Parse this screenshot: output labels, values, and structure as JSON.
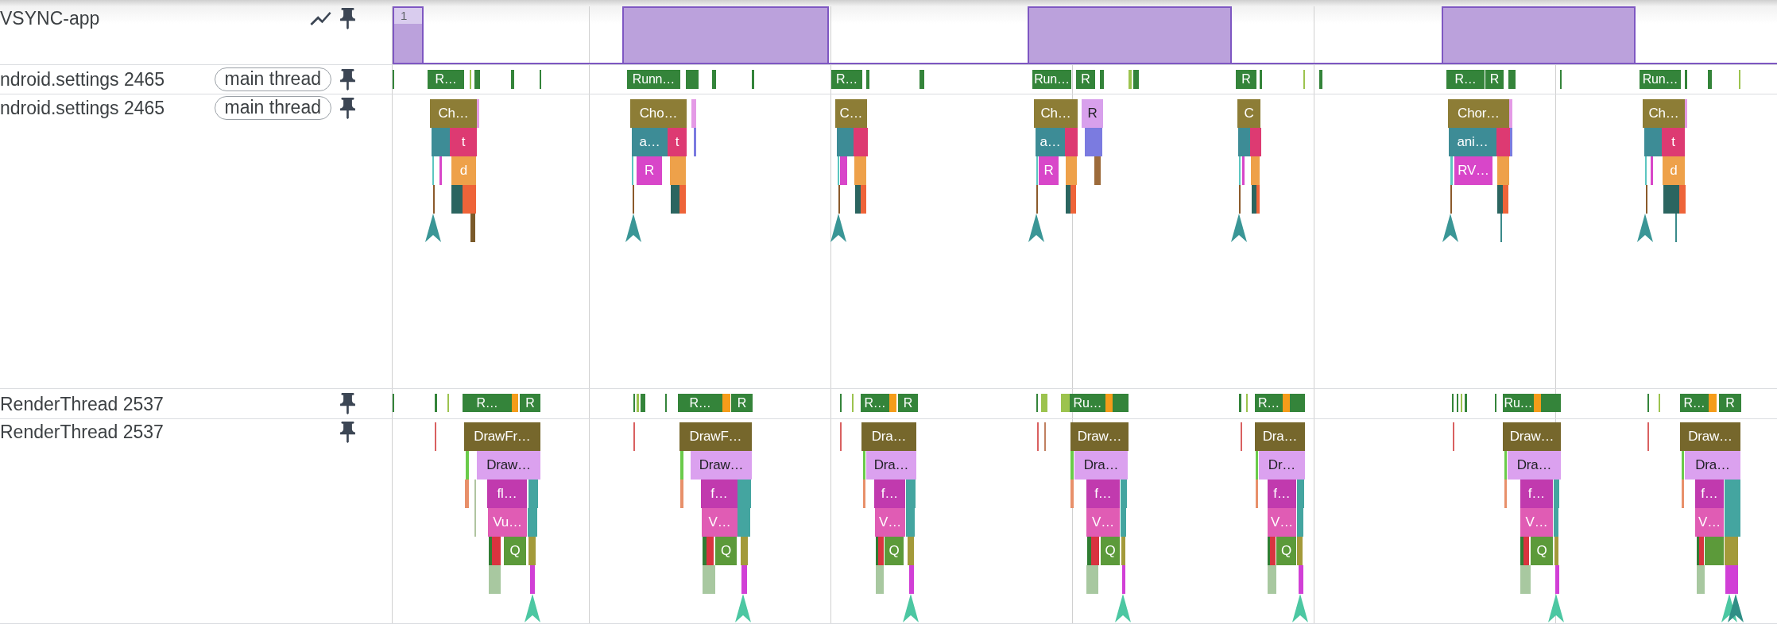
{
  "tracks": [
    {
      "kind": "counter",
      "title": "VSYNC-app",
      "value_label": "1"
    },
    {
      "kind": "thread_state",
      "title": "ndroid.settings 2465",
      "chip": "main thread",
      "slices": [
        {
          "color": "#34843a"
        },
        {
          "label": "R…",
          "color": "#34843a"
        },
        {
          "color": "#9cc34e"
        },
        {
          "color": "#34843a"
        },
        {
          "color": "#34843a"
        },
        {
          "color": "#34843a"
        },
        {
          "label": "Runn…",
          "color": "#34843a"
        },
        {
          "color": "#34843a"
        },
        {
          "color": "#34843a"
        },
        {
          "color": "#34843a"
        },
        {
          "label": "R…",
          "color": "#34843a"
        },
        {
          "color": "#34843a"
        },
        {
          "color": "#34843a"
        },
        {
          "label": "Run…",
          "color": "#34843a"
        },
        {
          "label": "R",
          "color": "#34843a"
        },
        {
          "color": "#34843a"
        },
        {
          "color": "#9cc34e"
        },
        {
          "color": "#34843a"
        },
        {
          "label": "R",
          "color": "#34843a"
        },
        {
          "color": "#34843a"
        },
        {
          "color": "#9cc34e"
        },
        {
          "color": "#34843a"
        },
        {
          "label": "R…",
          "color": "#34843a"
        },
        {
          "label": "R",
          "color": "#34843a"
        },
        {
          "color": "#34843a"
        },
        {
          "color": "#34843a"
        },
        {
          "label": "Run…",
          "color": "#34843a"
        },
        {
          "color": "#34843a"
        },
        {
          "color": "#34843a"
        },
        {
          "color": "#9cc34e"
        }
      ]
    },
    {
      "kind": "slices",
      "title": "ndroid.settings 2465",
      "chip": "main thread",
      "slices": [
        {
          "label": "Ch…",
          "color": "#8d7d36"
        },
        {
          "color": "#e49ae6"
        },
        {
          "color": "#3d8c96"
        },
        {
          "label": "t",
          "color": "#dd3a72"
        },
        {
          "color": "#5cc6c0"
        },
        {
          "color": "#d846c9"
        },
        {
          "label": "d",
          "color": "#eea14a"
        },
        {
          "color": "#8b5a2b"
        },
        {
          "color": "#2b6560"
        },
        {
          "color": "#ee6439"
        },
        {
          "color": "#7a5a2a"
        },
        {
          "label": "Cho…",
          "color": "#8d7d36"
        },
        {
          "color": "#e49ae6"
        },
        {
          "label": "a…",
          "color": "#3d8c96"
        },
        {
          "label": "t",
          "color": "#dd3a72"
        },
        {
          "color": "#7b7be0"
        },
        {
          "color": "#5cc6c0"
        },
        {
          "label": "R",
          "color": "#d846c9"
        },
        {
          "color": "#eea14a"
        },
        {
          "color": "#8b5a2b"
        },
        {
          "color": "#2b6560"
        },
        {
          "color": "#ee6439"
        },
        {
          "label": "C…",
          "color": "#8d7d36"
        },
        {
          "color": "#3d8c96"
        },
        {
          "color": "#dd3a72"
        },
        {
          "color": "#5cc6c0"
        },
        {
          "color": "#d846c9"
        },
        {
          "color": "#eea14a"
        },
        {
          "color": "#8b5a2b"
        },
        {
          "color": "#2b6560"
        },
        {
          "color": "#ee6439"
        },
        {
          "label": "Ch…",
          "color": "#8d7d36"
        },
        {
          "label": "R",
          "color": "#d8a0ec"
        },
        {
          "label": "a…",
          "color": "#3d8c96"
        },
        {
          "color": "#dd3a72"
        },
        {
          "color": "#7b7be0"
        },
        {
          "color": "#5cc6c0"
        },
        {
          "label": "R",
          "color": "#d846c9"
        },
        {
          "color": "#eea14a"
        },
        {
          "color": "#9c6a3a"
        },
        {
          "color": "#8b5a2b"
        },
        {
          "color": "#2b6560"
        },
        {
          "color": "#ee6439"
        },
        {
          "label": "C",
          "color": "#8d7d36"
        },
        {
          "color": "#3d8c96"
        },
        {
          "color": "#dd3a72"
        },
        {
          "color": "#5cc6c0"
        },
        {
          "color": "#d846c9"
        },
        {
          "color": "#eea14a"
        },
        {
          "color": "#8b5a2b"
        },
        {
          "color": "#2b6560"
        },
        {
          "color": "#ee6439"
        },
        {
          "label": "Chor…",
          "color": "#8d7d36"
        },
        {
          "color": "#e49ae6"
        },
        {
          "label": "ani…",
          "color": "#3d8c96"
        },
        {
          "color": "#dd3a72"
        },
        {
          "color": "#7b7be0"
        },
        {
          "color": "#5cc6c0"
        },
        {
          "label": "RV…",
          "color": "#d846c9"
        },
        {
          "color": "#eea14a"
        },
        {
          "color": "#8b5a2b"
        },
        {
          "color": "#2b6560"
        },
        {
          "color": "#ee6439"
        },
        {
          "color": "#3a8a8a"
        },
        {
          "label": "Ch…",
          "color": "#8d7d36"
        },
        {
          "color": "#e49ae6"
        },
        {
          "color": "#3d8c96"
        },
        {
          "label": "t",
          "color": "#dd3a72"
        },
        {
          "color": "#5cc6c0"
        },
        {
          "color": "#d846c9"
        },
        {
          "label": "d",
          "color": "#eea14a"
        },
        {
          "color": "#8b5a2b"
        },
        {
          "color": "#2b6560"
        },
        {
          "color": "#ee6439"
        },
        {
          "color": "#3a8a8a"
        }
      ]
    },
    {
      "kind": "thread_state",
      "title": "RenderThread 2537",
      "slices": [
        {
          "color": "#34843a"
        },
        {
          "color": "#34843a"
        },
        {
          "color": "#9cc34e"
        },
        {
          "label": "R…",
          "color": "#34843a"
        },
        {
          "color": "#f59c1a"
        },
        {
          "label": "R",
          "color": "#34843a"
        },
        {
          "color": "#34843a"
        },
        {
          "color": "#9cc34e"
        },
        {
          "color": "#34843a"
        },
        {
          "color": "#34843a"
        },
        {
          "label": "R…",
          "color": "#34843a"
        },
        {
          "color": "#f59c1a"
        },
        {
          "label": "R",
          "color": "#34843a"
        },
        {
          "color": "#34843a"
        },
        {
          "color": "#9cc34e"
        },
        {
          "label": "R…",
          "color": "#34843a"
        },
        {
          "color": "#f59c1a"
        },
        {
          "label": "R",
          "color": "#34843a"
        },
        {
          "color": "#34843a"
        },
        {
          "color": "#9cc34e"
        },
        {
          "color": "#9cc34e"
        },
        {
          "label": "Ru…",
          "color": "#34843a"
        },
        {
          "color": "#f59c1a"
        },
        {
          "color": "#34843a"
        },
        {
          "color": "#34843a"
        },
        {
          "color": "#9cc34e"
        },
        {
          "label": "R…",
          "color": "#34843a"
        },
        {
          "color": "#f59c1a"
        },
        {
          "color": "#34843a"
        },
        {
          "color": "#34843a"
        },
        {
          "color": "#34843a"
        },
        {
          "color": "#9cc34e"
        },
        {
          "color": "#34843a"
        },
        {
          "color": "#34843a"
        },
        {
          "label": "Ru…",
          "color": "#34843a"
        },
        {
          "color": "#f59c1a"
        },
        {
          "color": "#34843a"
        },
        {
          "color": "#34843a"
        },
        {
          "color": "#9cc34e"
        },
        {
          "label": "R…",
          "color": "#34843a"
        },
        {
          "color": "#f59c1a"
        },
        {
          "label": "R",
          "color": "#34843a"
        }
      ]
    },
    {
      "kind": "slices",
      "title": "RenderThread 2537",
      "slices": [
        {
          "color": "#d96060"
        },
        {
          "label": "DrawFr…",
          "color": "#76672c"
        },
        {
          "color": "#6acb4a"
        },
        {
          "label": "Draw…",
          "color": "#dba1ef"
        },
        {
          "color": "#e8906a"
        },
        {
          "color": "#b0c4a0"
        },
        {
          "label": "fl…",
          "color": "#c13aae"
        },
        {
          "color": "#44a5a0"
        },
        {
          "color": "#b0c4a0"
        },
        {
          "label": "Vu…",
          "color": "#e05cb4"
        },
        {
          "color": "#44a5a0"
        },
        {
          "color": "#2f7d32"
        },
        {
          "color": "#d9333f"
        },
        {
          "label": "Q",
          "color": "#5c9a3a"
        },
        {
          "color": "#a39a3a"
        },
        {
          "color": "#a8c8a0"
        },
        {
          "color": "#d13fd6"
        },
        {
          "color": "#d96060"
        },
        {
          "label": "DrawF…",
          "color": "#76672c"
        },
        {
          "color": "#6acb4a"
        },
        {
          "label": "Draw…",
          "color": "#dba1ef"
        },
        {
          "color": "#e8906a"
        },
        {
          "label": "f…",
          "color": "#c13aae"
        },
        {
          "color": "#44a5a0"
        },
        {
          "label": "V…",
          "color": "#e05cb4"
        },
        {
          "color": "#44a5a0"
        },
        {
          "color": "#2f7d32"
        },
        {
          "color": "#d9333f"
        },
        {
          "label": "Q",
          "color": "#5c9a3a"
        },
        {
          "color": "#a39a3a"
        },
        {
          "color": "#a8c8a0"
        },
        {
          "color": "#d13fd6"
        },
        {
          "color": "#d96060"
        },
        {
          "label": "Dra…",
          "color": "#76672c"
        },
        {
          "color": "#6acb4a"
        },
        {
          "label": "Dra…",
          "color": "#dba1ef"
        },
        {
          "color": "#e8906a"
        },
        {
          "label": "f…",
          "color": "#c13aae"
        },
        {
          "color": "#44a5a0"
        },
        {
          "label": "V…",
          "color": "#e05cb4"
        },
        {
          "color": "#44a5a0"
        },
        {
          "color": "#2f7d32"
        },
        {
          "color": "#d9333f"
        },
        {
          "label": "Q",
          "color": "#5c9a3a"
        },
        {
          "color": "#a39a3a"
        },
        {
          "color": "#a8c8a0"
        },
        {
          "color": "#d13fd6"
        },
        {
          "color": "#d96060"
        },
        {
          "color": "#c08060"
        },
        {
          "label": "Draw…",
          "color": "#76672c"
        },
        {
          "color": "#6acb4a"
        },
        {
          "label": "Dra…",
          "color": "#dba1ef"
        },
        {
          "color": "#e8906a"
        },
        {
          "label": "f…",
          "color": "#c13aae"
        },
        {
          "color": "#44a5a0"
        },
        {
          "label": "V…",
          "color": "#e05cb4"
        },
        {
          "color": "#44a5a0"
        },
        {
          "color": "#2f7d32"
        },
        {
          "color": "#d9333f"
        },
        {
          "label": "Q",
          "color": "#5c9a3a"
        },
        {
          "color": "#a39a3a"
        },
        {
          "color": "#a8c8a0"
        },
        {
          "color": "#d13fd6"
        },
        {
          "color": "#d96060"
        },
        {
          "label": "Dra…",
          "color": "#76672c"
        },
        {
          "color": "#6acb4a"
        },
        {
          "label": "Dr…",
          "color": "#dba1ef"
        },
        {
          "color": "#e8906a"
        },
        {
          "label": "f…",
          "color": "#c13aae"
        },
        {
          "color": "#44a5a0"
        },
        {
          "label": "V…",
          "color": "#e05cb4"
        },
        {
          "color": "#44a5a0"
        },
        {
          "color": "#2f7d32"
        },
        {
          "color": "#d9333f"
        },
        {
          "label": "Q",
          "color": "#5c9a3a"
        },
        {
          "color": "#a39a3a"
        },
        {
          "color": "#a8c8a0"
        },
        {
          "color": "#d13fd6"
        },
        {
          "color": "#d96060"
        },
        {
          "label": "Draw…",
          "color": "#76672c"
        },
        {
          "color": "#6acb4a"
        },
        {
          "label": "Dra…",
          "color": "#dba1ef"
        },
        {
          "color": "#e8906a"
        },
        {
          "label": "f…",
          "color": "#c13aae"
        },
        {
          "color": "#44a5a0"
        },
        {
          "label": "V…",
          "color": "#e05cb4"
        },
        {
          "color": "#44a5a0"
        },
        {
          "color": "#2f7d32"
        },
        {
          "color": "#d9333f"
        },
        {
          "label": "Q",
          "color": "#5c9a3a"
        },
        {
          "color": "#a39a3a"
        },
        {
          "color": "#a8c8a0"
        },
        {
          "color": "#d13fd6"
        },
        {
          "color": "#d96060"
        },
        {
          "label": "Draw…",
          "color": "#76672c"
        },
        {
          "color": "#6acb4a"
        },
        {
          "label": "Dra…",
          "color": "#dba1ef"
        },
        {
          "color": "#e8906a"
        },
        {
          "label": "f…",
          "color": "#c13aae"
        },
        {
          "color": "#44a5a0"
        },
        {
          "label": "V…",
          "color": "#e05cb4"
        },
        {
          "color": "#44a5a0"
        },
        {
          "color": "#2f7d32"
        },
        {
          "color": "#d9333f"
        },
        {
          "color": "#5c9a3a"
        },
        {
          "color": "#a39a3a"
        },
        {
          "color": "#a8c8a0"
        },
        {
          "color": "#d13fd6"
        }
      ]
    }
  ]
}
